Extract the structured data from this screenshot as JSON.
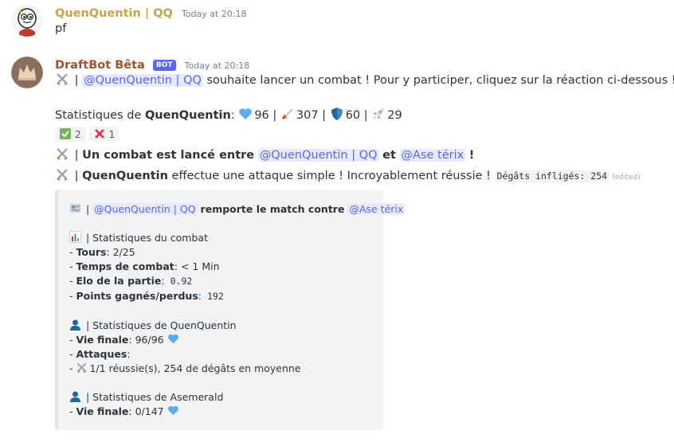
{
  "msg1": {
    "username": "QuenQuentin | QQ",
    "username_color": "#c4a64a",
    "timestamp": "Today at 20:18",
    "text": "pf"
  },
  "msg2": {
    "username": "DraftBot Bêta",
    "username_color": "#a0522d",
    "bot_tag": "BOT",
    "timestamp": "Today at 20:18",
    "line1": {
      "sep": " | ",
      "mention": "@QuenQuentin | QQ",
      "text": " souhaite lancer un combat ! Pour y participer, cliquez sur la réaction ci-dessous !"
    },
    "stats": {
      "prefix": "Statistiques de ",
      "name": "QuenQuentin",
      "colon": ": ",
      "hp": "96",
      "attack": "307",
      "defense": "60",
      "speed": "29",
      "sep": " | "
    },
    "reactions": [
      {
        "icon": "check-icon",
        "count": "2"
      },
      {
        "icon": "cross-icon",
        "count": "1"
      }
    ],
    "line2": {
      "sep": " | ",
      "bold": "Un combat est lancé entre",
      "mention1": "@QuenQuentin | QQ",
      "et": "et",
      "mention2": "@Ase térix",
      "bang": "!"
    },
    "line3": {
      "sep": " | ",
      "name": "QuenQuentin",
      "text": " effectue une attaque simple ! Incroyablement réussie ! ",
      "code": "Dégâts infligés: 254",
      "edited": "(edited)"
    }
  },
  "embed": {
    "title": {
      "sep": " | ",
      "mention1": "@QuenQuentin | QQ",
      "bold": "remporte le match contre",
      "mention2": "@Ase térix"
    },
    "combat_stats": {
      "header": " | Statistiques du combat",
      "tours_label": "Tours",
      "tours_value": ": 2/25",
      "temps_label": "Temps de combat",
      "temps_value": ": < 1 Min",
      "elo_label": "Elo de la partie",
      "elo_value": "0.92",
      "points_label": "Points gagnés/perdus",
      "points_value": "192"
    },
    "player1": {
      "header": " | Statistiques de QuenQuentin",
      "vie_label": "Vie finale",
      "vie_value": ": 96/96",
      "attaques_label": "Attaques",
      "attack_line": "1/1 réussie(s), 254 de dégâts en moyenne"
    },
    "player2": {
      "header": " | Statistiques de Asemerald",
      "vie_label": "Vie finale",
      "vie_value": ": 0/147"
    },
    "dash": "- ",
    "colon": ":"
  },
  "colors": {
    "mention_bg": "#e8eaff",
    "mention_fg": "#5865f2",
    "embed_bg": "#f2f3f5",
    "embed_border": "#e3e5e8"
  }
}
